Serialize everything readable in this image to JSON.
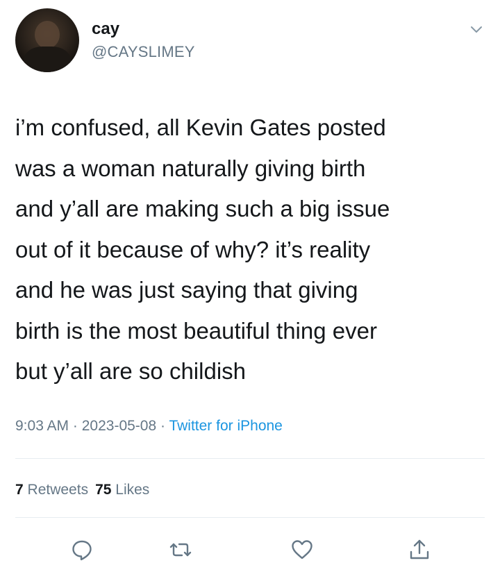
{
  "tweet": {
    "author": {
      "display_name": "cay",
      "handle": "@CAYSLIMEY",
      "avatar_icon": "profile-photo"
    },
    "text": "i’m confused, all Kevin Gates posted\nwas a woman naturally giving birth\nand y’all are making such a big issue\nout of it because of why? it’s reality\nand he was just saying that giving\nbirth is the most beautiful thing ever\nbut y’all are so childish",
    "time": "9:03 AM",
    "date": "2023-05-08",
    "separator": " · ",
    "source": "Twitter for iPhone",
    "stats": {
      "retweets_count": "7",
      "retweets_label": "Retweets",
      "likes_count": "75",
      "likes_label": "Likes"
    },
    "actions": [
      {
        "icon": "reply-icon"
      },
      {
        "icon": "retweet-icon"
      },
      {
        "icon": "like-icon"
      },
      {
        "icon": "share-icon"
      }
    ]
  },
  "colors": {
    "text": "#14171a",
    "secondary": "#657786",
    "link": "#1b95e0",
    "divider": "#e6ecf0"
  }
}
